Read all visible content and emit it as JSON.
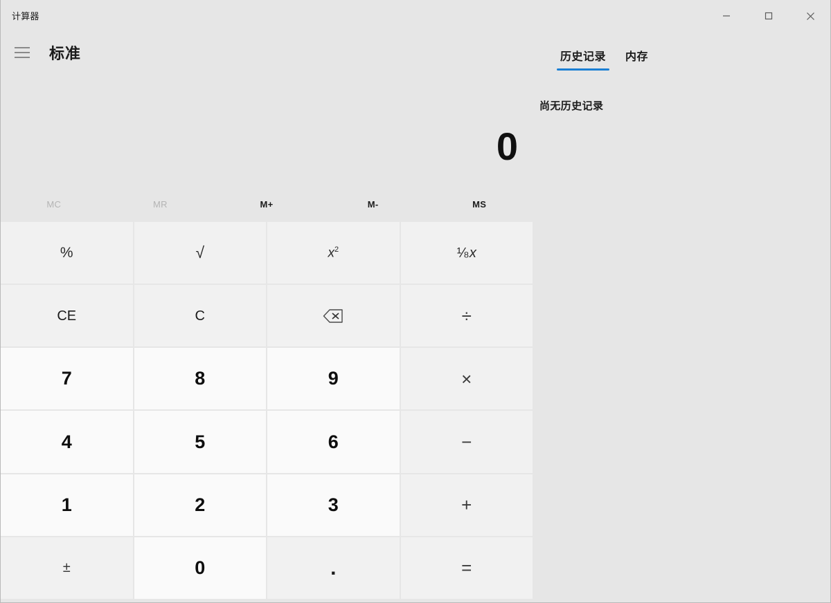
{
  "window": {
    "title": "计算器",
    "controls": [
      {
        "name": "minimize-button",
        "glyph": "minimize"
      },
      {
        "name": "maximize-button",
        "glyph": "maximize"
      },
      {
        "name": "close-button",
        "glyph": "close"
      }
    ]
  },
  "header": {
    "menu_icon": "hamburger-menu-icon",
    "mode_label": "标准"
  },
  "display": {
    "value": "0"
  },
  "memory_row": [
    {
      "label": "MC",
      "enabled": false
    },
    {
      "label": "MR",
      "enabled": false
    },
    {
      "label": "M+",
      "enabled": true
    },
    {
      "label": "M-",
      "enabled": true
    },
    {
      "label": "MS",
      "enabled": true
    }
  ],
  "keypad": {
    "row1": [
      {
        "name": "percent-key",
        "label": "%",
        "kind": "fn"
      },
      {
        "name": "sqrt-key",
        "label": "√",
        "kind": "fn"
      },
      {
        "name": "square-key",
        "label": "x2",
        "kind": "fn"
      },
      {
        "name": "reciprocal-key",
        "label": "1⁄x",
        "kind": "fn"
      }
    ],
    "row2": [
      {
        "name": "clear-entry-key",
        "label": "CE",
        "kind": "clr"
      },
      {
        "name": "clear-key",
        "label": "C",
        "kind": "clr"
      },
      {
        "name": "backspace-key",
        "label": "backspace",
        "kind": "clr"
      },
      {
        "name": "divide-key",
        "label": "÷",
        "kind": "op"
      }
    ],
    "row3": [
      {
        "name": "digit-7-key",
        "label": "7",
        "kind": "num"
      },
      {
        "name": "digit-8-key",
        "label": "8",
        "kind": "num"
      },
      {
        "name": "digit-9-key",
        "label": "9",
        "kind": "num"
      },
      {
        "name": "multiply-key",
        "label": "×",
        "kind": "op"
      }
    ],
    "row4": [
      {
        "name": "digit-4-key",
        "label": "4",
        "kind": "num"
      },
      {
        "name": "digit-5-key",
        "label": "5",
        "kind": "num"
      },
      {
        "name": "digit-6-key",
        "label": "6",
        "kind": "num"
      },
      {
        "name": "subtract-key",
        "label": "−",
        "kind": "op"
      }
    ],
    "row5": [
      {
        "name": "digit-1-key",
        "label": "1",
        "kind": "num"
      },
      {
        "name": "digit-2-key",
        "label": "2",
        "kind": "num"
      },
      {
        "name": "digit-3-key",
        "label": "3",
        "kind": "num"
      },
      {
        "name": "add-key",
        "label": "+",
        "kind": "op"
      }
    ],
    "row6": [
      {
        "name": "negate-key",
        "label": "±",
        "kind": "op"
      },
      {
        "name": "digit-0-key",
        "label": "0",
        "kind": "num"
      },
      {
        "name": "decimal-point-key",
        "label": ".",
        "kind": "op"
      },
      {
        "name": "equals-key",
        "label": "=",
        "kind": "op"
      }
    ]
  },
  "side_panel": {
    "tabs": [
      {
        "label": "历史记录",
        "active": true
      },
      {
        "label": "内存",
        "active": false
      }
    ],
    "empty_message": "尚无历史记录"
  },
  "colors": {
    "window_bg": "#e6e6e6",
    "key_bg": "#f1f1f1",
    "number_key_bg": "#fafafa",
    "accent": "#1a7fd4",
    "text": "#1b1b1b",
    "disabled_text": "#b4b4b4"
  }
}
